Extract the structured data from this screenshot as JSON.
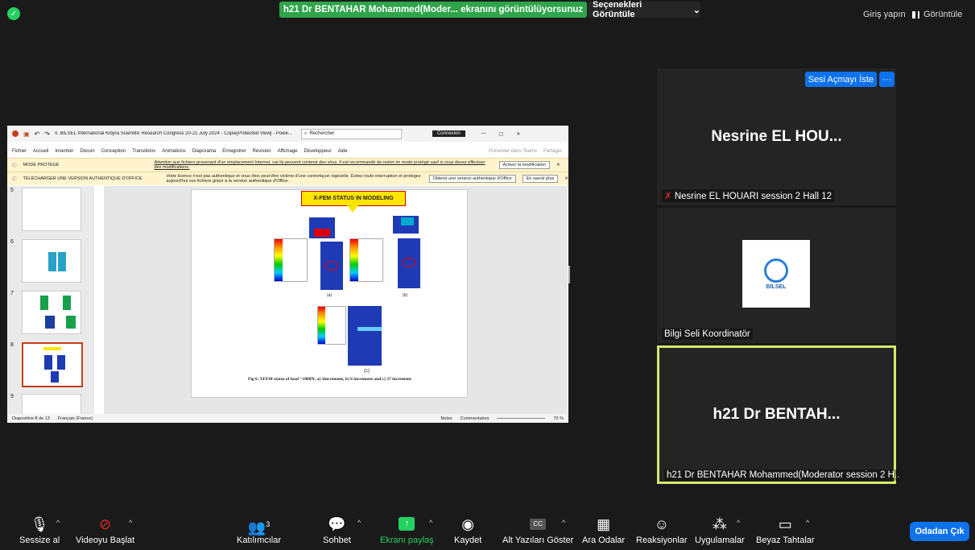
{
  "top": {
    "share_banner": "h21 Dr BENTAHAR Mohammed(Moder... ekranını görüntülüyorsunuz",
    "view_options": "Seçenekleri Görüntüle",
    "signin": "Giriş yapın",
    "view": "Görüntüle"
  },
  "shared": {
    "window_title": "II. BİLSEL International Kibyra Scientific Research Congress 20-21 July 2024 - Copie[Protected View] - Powe...",
    "search_placeholder": "Rechercher",
    "connexion": "Connexion",
    "menu": [
      "Fichier",
      "Accueil",
      "Insertion",
      "Dessin",
      "Conception",
      "Transitions",
      "Animations",
      "Diaporama",
      "Enregistrer",
      "Révision",
      "Affichage",
      "Développeur",
      "Aide"
    ],
    "present_teams": "Présenter dans Teams",
    "share": "Partager",
    "warn1_title": "MODE PROTÉGÉ",
    "warn1_text": "Attention aux fichiers provenant d'un emplacement Internet, car ils peuvent contenir des virus. Il est recommandé de rester en mode protégé sauf si vous devez effectuer des modifications.",
    "warn1_btn": "Activer la modification",
    "warn2_title": "TÉLÉCHARGER UNE VERSION AUTHENTIQUE D'OFFICE",
    "warn2_text": "Votre licence n'est pas authentique et vous êtes peut-être victime d'une contrefaçon logicielle. Évitez toute interruption et protégez aujourd'hui vos fichiers grâce à la version authentique d'Office.",
    "warn2_btn1": "Obtenir une version authentique d'Office",
    "warn2_btn2": "En savoir plus",
    "thumb_numbers": [
      "5",
      "6",
      "7",
      "8",
      "9"
    ],
    "slide_badge": "X-FEM STATUS IN MODELING",
    "sub_a": "(a)",
    "sub_b": "(b)",
    "sub_c": "(c)",
    "caption": "Fig 6.  XFEM statut of load =1000N; a) 3increment,  b) 6 increment and c) 37 increment",
    "status_slide": "Diapositive 8 de 13",
    "status_lang": "Français (France)",
    "status_notes": "Notes",
    "status_comments": "Commentaires",
    "status_zoom": "70 %"
  },
  "tiles": [
    {
      "big": "Nesrine EL HOU...",
      "name": "Nesrine EL HOUARI session 2 Hall 12",
      "button": "Sesi Açmayı İste"
    },
    {
      "logo_text": "BİLSEL",
      "name": "Bilgi Seli Koordinatör"
    },
    {
      "big": "h21 Dr BENTAH...",
      "name": "h21 Dr BENTAHAR Mohammed(Moderator session 2 H..."
    }
  ],
  "toolbar": {
    "mute": "Sessize al",
    "video": "Videoyu Başlat",
    "participants": "Katılımcılar",
    "participants_count": "3",
    "chat": "Sohbet",
    "share": "Ekranı paylaş",
    "record": "Kaydet",
    "captions": "Alt Yazıları Göster",
    "breakout": "Ara Odalar",
    "reactions": "Reaksiyonlar",
    "apps": "Uygulamalar",
    "whiteboard": "Beyaz Tahtalar",
    "leave": "Odadan Çık"
  },
  "colors": {
    "share_green": "#2ea54a",
    "leave_blue": "#0e72ed",
    "active_border": "#d6e86b"
  }
}
